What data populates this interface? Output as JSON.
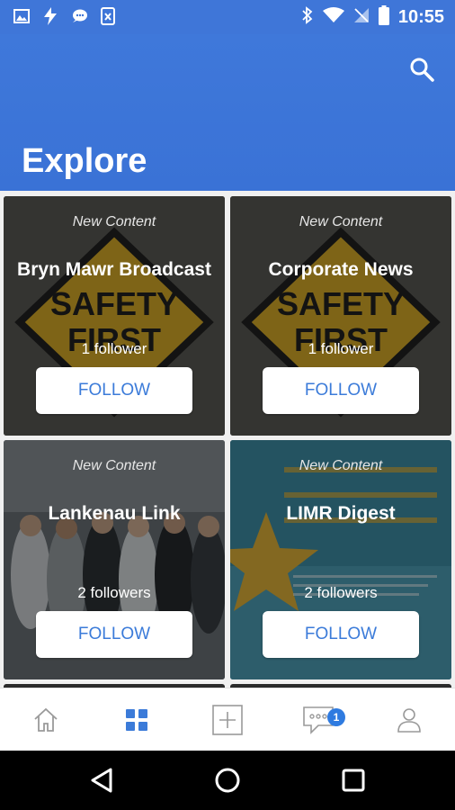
{
  "status_bar": {
    "time": "10:55"
  },
  "header": {
    "title": "Explore"
  },
  "cards": [
    {
      "new_label": "New Content",
      "name": "Bryn Mawr Broadcast",
      "followers": "1 follower",
      "follow_label": "FOLLOW",
      "bg_text_1": "SAFETY",
      "bg_text_2": "FIRST"
    },
    {
      "new_label": "New Content",
      "name": "Corporate News",
      "followers": "1 follower",
      "follow_label": "FOLLOW",
      "bg_text_1": "SAFETY",
      "bg_text_2": "FIRST"
    },
    {
      "new_label": "New Content",
      "name": "Lankenau Link",
      "followers": "2 followers",
      "follow_label": "FOLLOW"
    },
    {
      "new_label": "New Content",
      "name": "LIMR Digest",
      "followers": "2 followers",
      "follow_label": "FOLLOW"
    }
  ],
  "bottom_nav": {
    "items": [
      {
        "icon": "home-icon"
      },
      {
        "icon": "grid-icon",
        "active": true
      },
      {
        "icon": "add-post-icon"
      },
      {
        "icon": "messages-icon",
        "badge": "1"
      },
      {
        "icon": "profile-icon"
      }
    ]
  },
  "colors": {
    "primary": "#3f76d8",
    "active_nav": "#3b7bd9",
    "follow_text": "#3b7bd9"
  }
}
